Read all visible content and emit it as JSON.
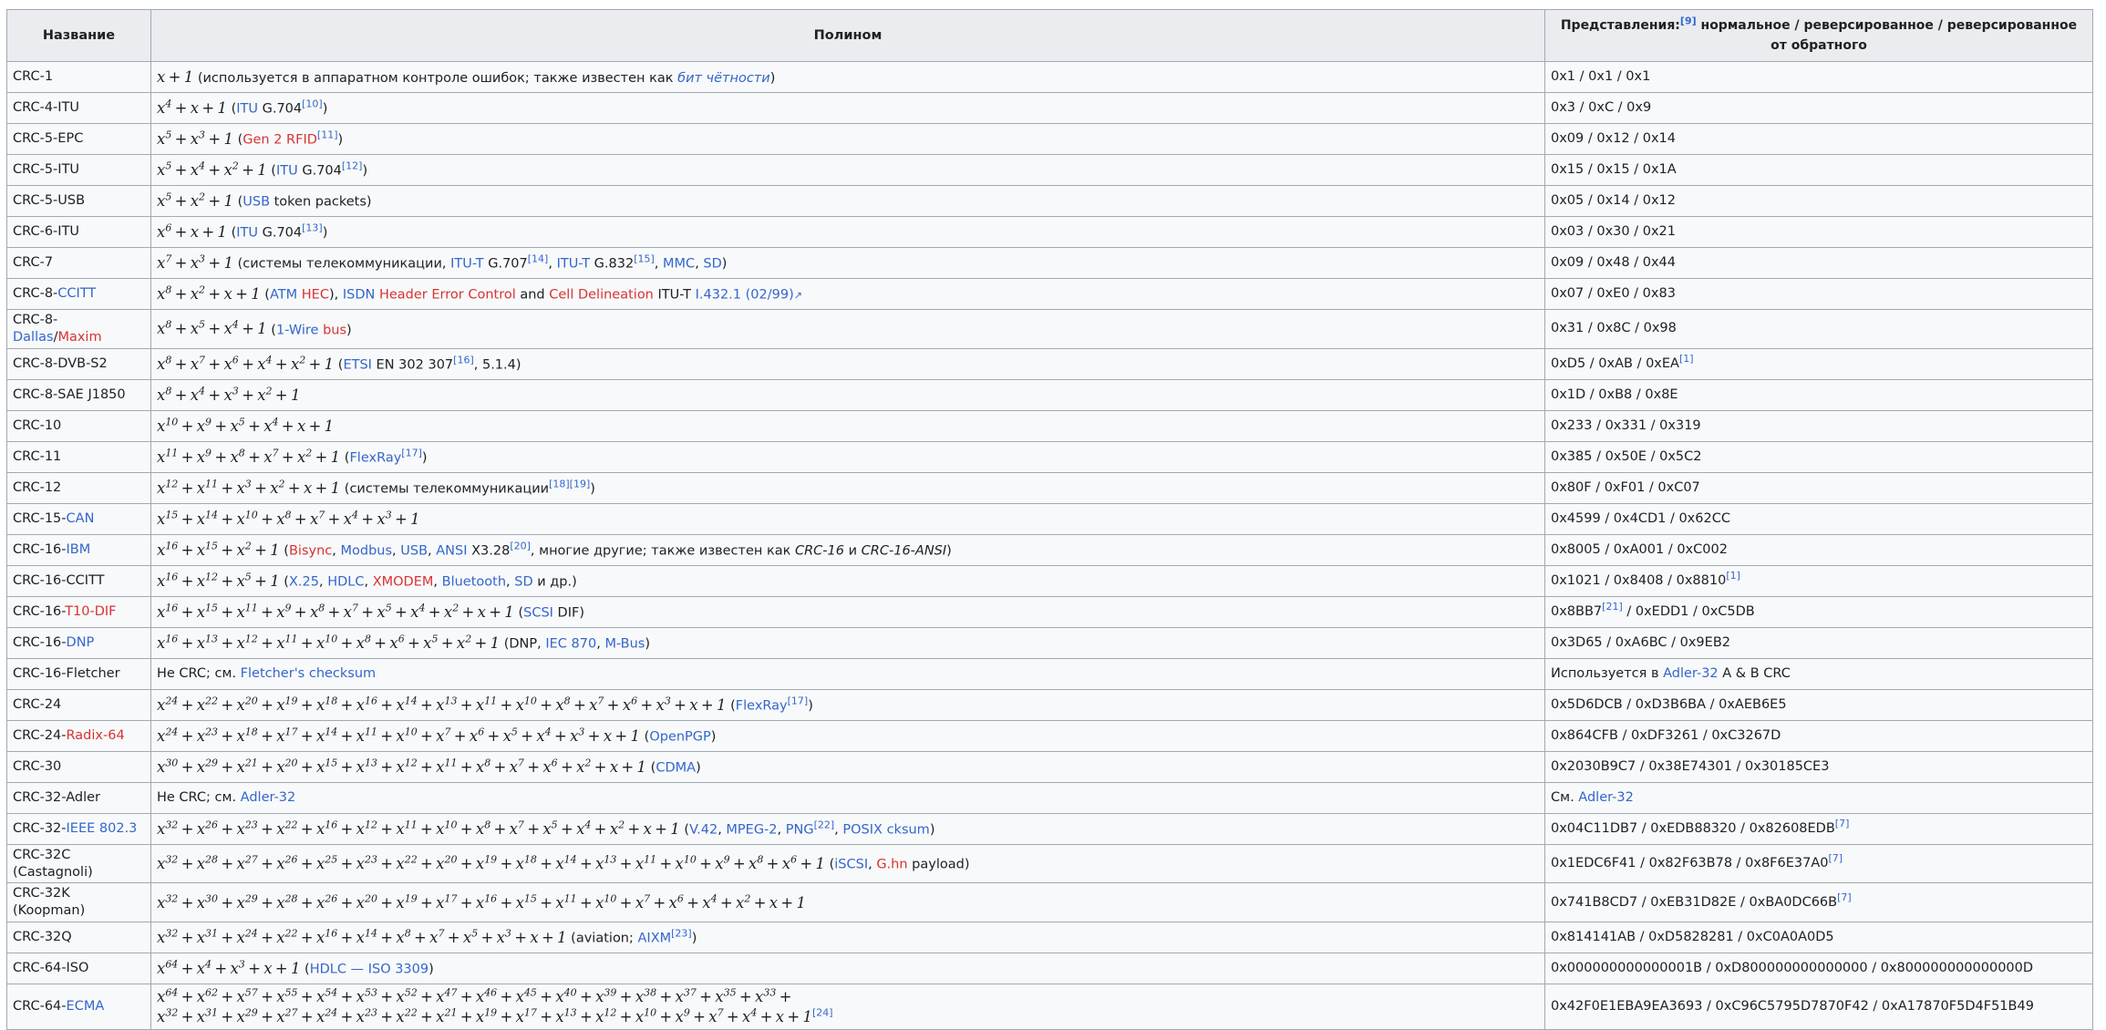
{
  "header": {
    "col_name": "Название",
    "col_poly": "Полином",
    "col_repr_pre": "Представления:",
    "col_repr_ref": "[9]",
    "col_repr_post": " нормальное / реверсированное / реверсированное от обратного"
  },
  "rows": [
    {
      "name": [
        {
          "t": "CRC-1"
        }
      ],
      "poly": [
        {
          "m": "x + 1"
        },
        {
          "t": " (используется в аппаратном контроле ошибок; также известен как "
        },
        {
          "l": "бит чётности",
          "i": true
        },
        {
          "t": ")"
        }
      ],
      "repr": [
        {
          "t": "0x1 / 0x1 / 0x1"
        }
      ]
    },
    {
      "name": [
        {
          "t": "CRC-4-ITU"
        }
      ],
      "poly": [
        {
          "m": "x^4 + x + 1"
        },
        {
          "t": " ("
        },
        {
          "l": "ITU"
        },
        {
          "t": " G.704"
        },
        {
          "ref": "[10]"
        },
        {
          "t": ")"
        }
      ],
      "repr": [
        {
          "t": "0x3 / 0xC / 0x9"
        }
      ]
    },
    {
      "name": [
        {
          "t": "CRC-5-EPC"
        }
      ],
      "poly": [
        {
          "m": "x^5 + x^3 + 1"
        },
        {
          "t": " ("
        },
        {
          "rl": "Gen 2 RFID"
        },
        {
          "ref": "[11]"
        },
        {
          "t": ")"
        }
      ],
      "repr": [
        {
          "t": "0x09 / 0x12 / 0x14"
        }
      ]
    },
    {
      "name": [
        {
          "t": "CRC-5-ITU"
        }
      ],
      "poly": [
        {
          "m": "x^5 + x^4 + x^2 + 1"
        },
        {
          "t": " ("
        },
        {
          "l": "ITU"
        },
        {
          "t": " G.704"
        },
        {
          "ref": "[12]"
        },
        {
          "t": ")"
        }
      ],
      "repr": [
        {
          "t": "0x15 / 0x15 / 0x1A"
        }
      ]
    },
    {
      "name": [
        {
          "t": "CRC-5-USB"
        }
      ],
      "poly": [
        {
          "m": "x^5 + x^2 + 1"
        },
        {
          "t": " ("
        },
        {
          "l": "USB"
        },
        {
          "t": " token packets)"
        }
      ],
      "repr": [
        {
          "t": "0x05 / 0x14 / 0x12"
        }
      ]
    },
    {
      "name": [
        {
          "t": "CRC-6-ITU"
        }
      ],
      "poly": [
        {
          "m": "x^6 + x + 1"
        },
        {
          "t": " ("
        },
        {
          "l": "ITU"
        },
        {
          "t": " G.704"
        },
        {
          "ref": "[13]"
        },
        {
          "t": ")"
        }
      ],
      "repr": [
        {
          "t": "0x03 / 0x30 / 0x21"
        }
      ]
    },
    {
      "name": [
        {
          "t": "CRC-7"
        }
      ],
      "poly": [
        {
          "m": "x^7 + x^3 + 1"
        },
        {
          "t": " (системы телекоммуникации, "
        },
        {
          "l": "ITU-T"
        },
        {
          "t": " G.707"
        },
        {
          "ref": "[14]"
        },
        {
          "t": ", "
        },
        {
          "l": "ITU-T"
        },
        {
          "t": " G.832"
        },
        {
          "ref": "[15]"
        },
        {
          "t": ", "
        },
        {
          "l": "MMC"
        },
        {
          "t": ", "
        },
        {
          "l": "SD"
        },
        {
          "t": ")"
        }
      ],
      "repr": [
        {
          "t": "0x09 / 0x48 / 0x44"
        }
      ]
    },
    {
      "name": [
        {
          "t": "CRC-8-"
        },
        {
          "l": "CCITT"
        }
      ],
      "poly": [
        {
          "m": "x^8 + x^2 + x + 1"
        },
        {
          "t": " ("
        },
        {
          "l": "ATM"
        },
        {
          "t": " "
        },
        {
          "rl": "HEC"
        },
        {
          "t": "), "
        },
        {
          "l": "ISDN"
        },
        {
          "t": " "
        },
        {
          "rl": "Header Error Control"
        },
        {
          "t": " and "
        },
        {
          "rl": "Cell Delineation"
        },
        {
          "t": " ITU-T "
        },
        {
          "l": "I.432.1 (02/99)"
        },
        {
          "ext": "↗"
        }
      ],
      "repr": [
        {
          "t": "0x07 / 0xE0 / 0x83"
        }
      ]
    },
    {
      "name": [
        {
          "t": "CRC-8-"
        },
        {
          "l": "Dallas"
        },
        {
          "t": "/"
        },
        {
          "rl": "Maxim"
        }
      ],
      "poly": [
        {
          "m": "x^8 + x^5 + x^4 + 1"
        },
        {
          "t": " ("
        },
        {
          "l": "1-Wire"
        },
        {
          "t": " "
        },
        {
          "rl": "bus"
        },
        {
          "t": ")"
        }
      ],
      "repr": [
        {
          "t": "0x31 / 0x8C / 0x98"
        }
      ]
    },
    {
      "name": [
        {
          "t": "CRC-8-DVB-S2"
        }
      ],
      "poly": [
        {
          "m": "x^8 + x^7 + x^6 + x^4 + x^2 + 1"
        },
        {
          "t": " ("
        },
        {
          "l": "ETSI"
        },
        {
          "t": " EN 302 307"
        },
        {
          "ref": "[16]"
        },
        {
          "t": ", 5.1.4)"
        }
      ],
      "repr": [
        {
          "t": "0xD5 / 0xAB / 0xEA"
        },
        {
          "ref": "[1]"
        }
      ]
    },
    {
      "name": [
        {
          "t": "CRC-8-SAE J1850"
        }
      ],
      "poly": [
        {
          "m": "x^8 + x^4 + x^3 + x^2 + 1"
        }
      ],
      "repr": [
        {
          "t": "0x1D / 0xB8 / 0x8E"
        }
      ]
    },
    {
      "name": [
        {
          "t": "CRC-10"
        }
      ],
      "poly": [
        {
          "m": "x^10 + x^9 + x^5 + x^4 + x + 1"
        }
      ],
      "repr": [
        {
          "t": "0x233 / 0x331 / 0x319"
        }
      ]
    },
    {
      "name": [
        {
          "t": "CRC-11"
        }
      ],
      "poly": [
        {
          "m": "x^11 + x^9 + x^8 + x^7 + x^2 + 1"
        },
        {
          "t": " ("
        },
        {
          "l": "FlexRay"
        },
        {
          "ref": "[17]"
        },
        {
          "t": ")"
        }
      ],
      "repr": [
        {
          "t": "0x385 / 0x50E / 0x5C2"
        }
      ]
    },
    {
      "name": [
        {
          "t": "CRC-12"
        }
      ],
      "poly": [
        {
          "m": "x^12 + x^11 + x^3 + x^2 + x + 1"
        },
        {
          "t": " (системы телекоммуникации"
        },
        {
          "ref": "[18]"
        },
        {
          "ref": "[19]"
        },
        {
          "t": ")"
        }
      ],
      "repr": [
        {
          "t": "0x80F / 0xF01 / 0xC07"
        }
      ]
    },
    {
      "name": [
        {
          "t": "CRC-15-"
        },
        {
          "l": "CAN"
        }
      ],
      "poly": [
        {
          "m": "x^15 + x^14 + x^10 + x^8 + x^7 + x^4 + x^3 + 1"
        }
      ],
      "repr": [
        {
          "t": "0x4599 / 0x4CD1 / 0x62CC"
        }
      ]
    },
    {
      "name": [
        {
          "t": "CRC-16-"
        },
        {
          "l": "IBM"
        }
      ],
      "poly": [
        {
          "m": "x^16 + x^15 + x^2 + 1"
        },
        {
          "t": " ("
        },
        {
          "rl": "Bisync"
        },
        {
          "t": ", "
        },
        {
          "l": "Modbus"
        },
        {
          "t": ", "
        },
        {
          "l": "USB"
        },
        {
          "t": ", "
        },
        {
          "l": "ANSI"
        },
        {
          "t": " X3.28"
        },
        {
          "ref": "[20]"
        },
        {
          "t": ", многие другие; также известен как "
        },
        {
          "it": "CRC-16"
        },
        {
          "t": " и "
        },
        {
          "it": "CRC-16-ANSI"
        },
        {
          "t": ")"
        }
      ],
      "repr": [
        {
          "t": "0x8005 / 0xA001 / 0xC002"
        }
      ]
    },
    {
      "name": [
        {
          "t": "CRC-16-CCITT"
        }
      ],
      "poly": [
        {
          "m": "x^16 + x^12 + x^5 + 1"
        },
        {
          "t": " ("
        },
        {
          "l": "X.25"
        },
        {
          "t": ", "
        },
        {
          "l": "HDLC"
        },
        {
          "t": ", "
        },
        {
          "rl": "XMODEM"
        },
        {
          "t": ", "
        },
        {
          "l": "Bluetooth"
        },
        {
          "t": ", "
        },
        {
          "l": "SD"
        },
        {
          "t": " и др.)"
        }
      ],
      "repr": [
        {
          "t": "0x1021 / 0x8408 / 0x8810"
        },
        {
          "ref": "[1]"
        }
      ]
    },
    {
      "name": [
        {
          "t": "CRC-16-"
        },
        {
          "rl": "T10-DIF"
        }
      ],
      "poly": [
        {
          "m": "x^16 + x^15 + x^11 + x^9 + x^8 + x^7 + x^5 + x^4 + x^2 + x + 1"
        },
        {
          "t": " ("
        },
        {
          "l": "SCSI"
        },
        {
          "t": " DIF)"
        }
      ],
      "repr": [
        {
          "t": "0x8BB7"
        },
        {
          "ref": "[21]"
        },
        {
          "t": " / 0xEDD1 / 0xC5DB"
        }
      ]
    },
    {
      "name": [
        {
          "t": "CRC-16-"
        },
        {
          "l": "DNP"
        }
      ],
      "poly": [
        {
          "m": "x^16 + x^13 + x^12 + x^11 + x^10 + x^8 + x^6 + x^5 + x^2 + 1"
        },
        {
          "t": " (DNP, "
        },
        {
          "l": "IEC 870"
        },
        {
          "t": ", "
        },
        {
          "l": "M-Bus"
        },
        {
          "t": ")"
        }
      ],
      "repr": [
        {
          "t": "0x3D65 / 0xA6BC / 0x9EB2"
        }
      ]
    },
    {
      "name": [
        {
          "t": "CRC-16-Fletcher"
        }
      ],
      "poly": [
        {
          "t": "Не CRC; см. "
        },
        {
          "l": "Fletcher's checksum"
        }
      ],
      "repr": [
        {
          "t": "Используется в "
        },
        {
          "l": "Adler-32"
        },
        {
          "t": " A & B CRC"
        }
      ]
    },
    {
      "name": [
        {
          "t": "CRC-24"
        }
      ],
      "poly": [
        {
          "m": "x^24 + x^22 + x^20 + x^19 + x^18 + x^16 + x^14 + x^13 + x^11 + x^10 + x^8 + x^7 + x^6 + x^3 + x + 1"
        },
        {
          "t": " ("
        },
        {
          "l": "FlexRay"
        },
        {
          "ref": "[17]"
        },
        {
          "t": ")"
        }
      ],
      "repr": [
        {
          "t": "0x5D6DCB / 0xD3B6BA / 0xAEB6E5"
        }
      ]
    },
    {
      "name": [
        {
          "t": "CRC-24-"
        },
        {
          "rl": "Radix-64"
        }
      ],
      "poly": [
        {
          "m": "x^24 + x^23 + x^18 + x^17 + x^14 + x^11 + x^10 + x^7 + x^6 + x^5 + x^4 + x^3 + x + 1"
        },
        {
          "t": " ("
        },
        {
          "l": "OpenPGP"
        },
        {
          "t": ")"
        }
      ],
      "repr": [
        {
          "t": "0x864CFB / 0xDF3261 / 0xC3267D"
        }
      ]
    },
    {
      "name": [
        {
          "t": "CRC-30"
        }
      ],
      "poly": [
        {
          "m": "x^30 + x^29 + x^21 + x^20 + x^15 + x^13 + x^12 + x^11 + x^8 + x^7 + x^6 + x^2 + x + 1"
        },
        {
          "t": " ("
        },
        {
          "l": "CDMA"
        },
        {
          "t": ")"
        }
      ],
      "repr": [
        {
          "t": "0x2030B9C7 / 0x38E74301 / 0x30185CE3"
        }
      ]
    },
    {
      "name": [
        {
          "t": "CRC-32-Adler"
        }
      ],
      "poly": [
        {
          "t": "Не CRC; см. "
        },
        {
          "l": "Adler-32"
        }
      ],
      "repr": [
        {
          "t": "См. "
        },
        {
          "l": "Adler-32"
        }
      ]
    },
    {
      "name": [
        {
          "t": "CRC-32-"
        },
        {
          "l": "IEEE 802.3"
        }
      ],
      "poly": [
        {
          "m": "x^32 + x^26 + x^23 + x^22 + x^16 + x^12 + x^11 + x^10 + x^8 + x^7 + x^5 + x^4 + x^2 + x + 1"
        },
        {
          "t": " ("
        },
        {
          "l": "V.42"
        },
        {
          "t": ", "
        },
        {
          "l": "MPEG-2"
        },
        {
          "t": ", "
        },
        {
          "l": "PNG"
        },
        {
          "ref": "[22]"
        },
        {
          "t": ", "
        },
        {
          "l": "POSIX cksum"
        },
        {
          "t": ")"
        }
      ],
      "repr": [
        {
          "t": "0x04C11DB7 / 0xEDB88320 / 0x82608EDB"
        },
        {
          "ref": "[7]"
        }
      ]
    },
    {
      "name": [
        {
          "t": "CRC-32C (Castagnoli)"
        }
      ],
      "poly": [
        {
          "m": "x^32 + x^28 + x^27 + x^26 + x^25 + x^23 + x^22 + x^20 + x^19 + x^18 + x^14 + x^13 + x^11 + x^10 + x^9 + x^8 + x^6 + 1"
        },
        {
          "t": " ("
        },
        {
          "l": "iSCSI"
        },
        {
          "t": ", "
        },
        {
          "rl": "G.hn"
        },
        {
          "t": " payload)"
        }
      ],
      "repr": [
        {
          "t": "0x1EDC6F41 / 0x82F63B78 / 0x8F6E37A0"
        },
        {
          "ref": "[7]"
        }
      ]
    },
    {
      "name": [
        {
          "t": "CRC-32K (Koopman)"
        }
      ],
      "poly": [
        {
          "m": "x^32 + x^30 + x^29 + x^28 + x^26 + x^20 + x^19 + x^17 + x^16 + x^15 + x^11 + x^10 + x^7 + x^6 + x^4 + x^2 + x + 1"
        }
      ],
      "repr": [
        {
          "t": "0x741B8CD7 / 0xEB31D82E / 0xBA0DC66B"
        },
        {
          "ref": "[7]"
        }
      ]
    },
    {
      "name": [
        {
          "t": "CRC-32Q"
        }
      ],
      "poly": [
        {
          "m": "x^32 + x^31 + x^24 + x^22 + x^16 + x^14 + x^8 + x^7 + x^5 + x^3 + x + 1"
        },
        {
          "t": " (aviation; "
        },
        {
          "l": "AIXM"
        },
        {
          "ref": "[23]"
        },
        {
          "t": ")"
        }
      ],
      "repr": [
        {
          "t": "0x814141AB / 0xD5828281 / 0xC0A0A0D5"
        }
      ]
    },
    {
      "name": [
        {
          "t": "CRC-64-ISO"
        }
      ],
      "poly": [
        {
          "m": "x^64 + x^4 + x^3 + x + 1"
        },
        {
          "t": " ("
        },
        {
          "l": "HDLC — ISO 3309"
        },
        {
          "t": ")"
        }
      ],
      "repr": [
        {
          "t": "0x000000000000001B / 0xD800000000000000 / 0x800000000000000D"
        }
      ]
    },
    {
      "name": [
        {
          "t": "CRC-64-"
        },
        {
          "l": "ECMA"
        }
      ],
      "poly": [
        {
          "m": "x^64 + x^62 + x^57 + x^55 + x^54 + x^53 + x^52 + x^47 + x^46 + x^45 + x^40 + x^39 + x^38 + x^37 + x^35 + x^33 +"
        },
        {
          "br": true
        },
        {
          "m": "x^32 + x^31 + x^29 + x^27 + x^24 + x^23 + x^22 + x^21 + x^19 + x^17 + x^13 + x^12 + x^10 + x^9 + x^7 + x^4 + x + 1"
        },
        {
          "ref": "[24]"
        }
      ],
      "repr": [
        {
          "t": "0x42F0E1EBA9EA3693 / 0xC96C5795D7870F42 / 0xA17870F5D4F51B49"
        }
      ]
    }
  ]
}
